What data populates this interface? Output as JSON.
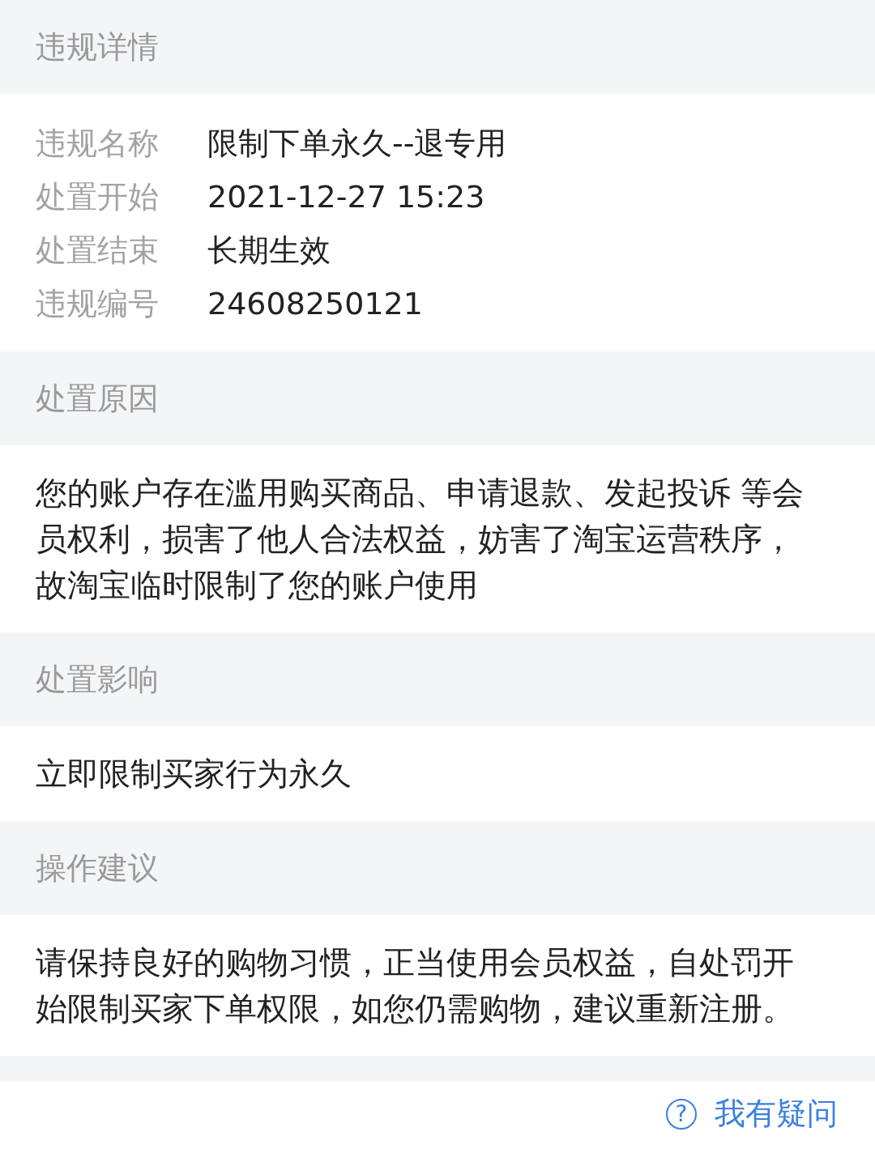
{
  "sections": [
    {
      "title": "违规详情",
      "kind": "fields",
      "fields": [
        {
          "label": "违规名称",
          "value": "限制下单永久--退专用"
        },
        {
          "label": "处置开始",
          "value": "2021-12-27 15:23"
        },
        {
          "label": "处置结束",
          "value": "长期生效"
        },
        {
          "label": "违规编号",
          "value": "24608250121"
        }
      ]
    },
    {
      "title": "处置原因",
      "kind": "text",
      "text": "您的账户存在滥用购买商品、申请退款、发起投诉 等会员权利，损害了他人合法权益，妨害了淘宝运营秩序，故淘宝临时限制了您的账户使用"
    },
    {
      "title": "处置影响",
      "kind": "text",
      "text": "立即限制买家行为永久"
    },
    {
      "title": "操作建议",
      "kind": "text",
      "text": "请保持良好的购物习惯，正当使用会员权益，自处罚开始限制买家下单权限，如您仍需购物，建议重新注册。"
    }
  ],
  "help_link": {
    "icon": "?",
    "label": "我有疑问"
  }
}
